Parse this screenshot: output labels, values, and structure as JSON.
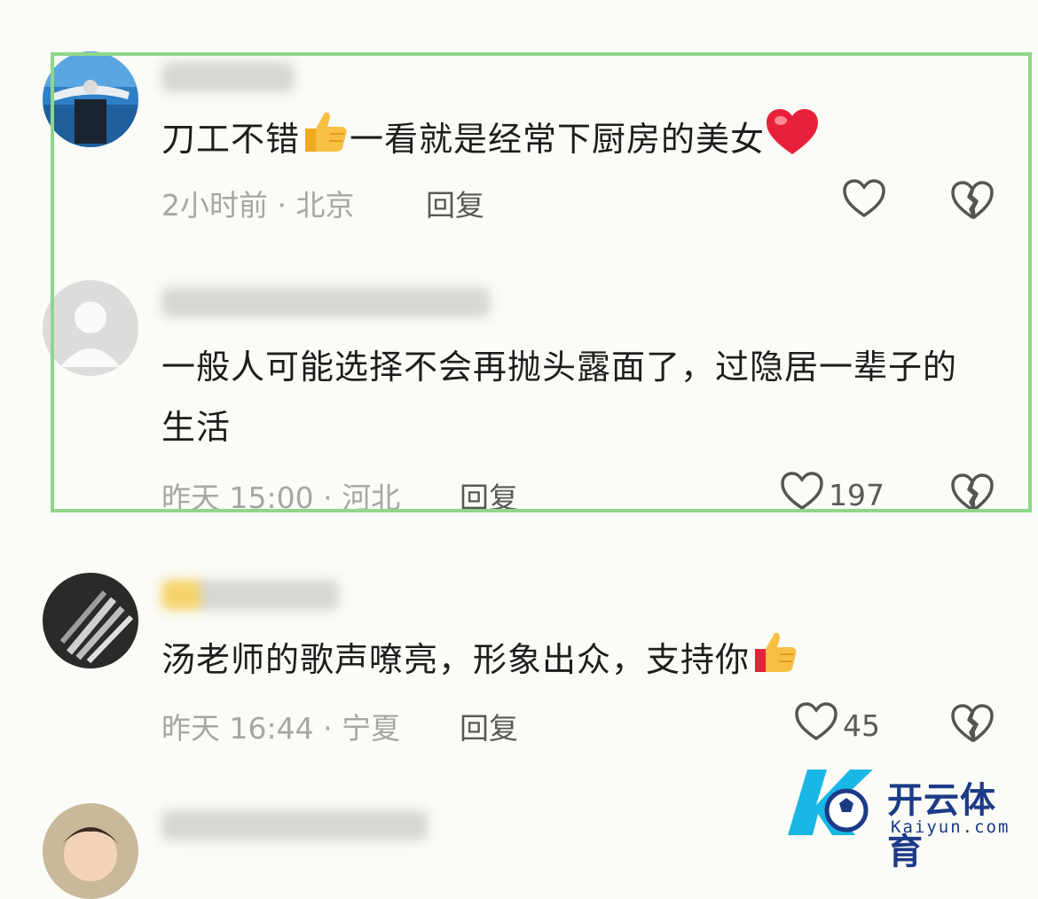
{
  "comments": [
    {
      "text": "刀工不错",
      "text_after_thumb": "一看就是经常下厨房的美女",
      "time": "2小时前",
      "location": "北京",
      "reply": "回复",
      "likes": "",
      "avatar_icon": "swimmer-avatar"
    },
    {
      "text": "一般人可能选择不会再抛头露面了，过隐居一辈子的生活",
      "time": "昨天 15:00",
      "location": "河北",
      "reply": "回复",
      "likes": "197",
      "avatar_icon": "default-user-avatar"
    },
    {
      "text": "汤老师的歌声嘹亮，形象出众，支持你",
      "time": "昨天 16:44",
      "location": "宁夏",
      "reply": "回复",
      "likes": "45",
      "avatar_icon": "striped-avatar"
    },
    {
      "avatar_icon": "child-photo-avatar"
    }
  ],
  "watermark": {
    "cn": "开云体育",
    "en": "Kaiyun.com"
  },
  "colors": {
    "highlight": "#8fd68a",
    "meta_text": "#a6a6a6",
    "heart_red": "#e8213a",
    "thumb_yellow": "#f7b733",
    "logo_blue": "#1c3b87",
    "logo_cyan": "#19b7e6"
  }
}
